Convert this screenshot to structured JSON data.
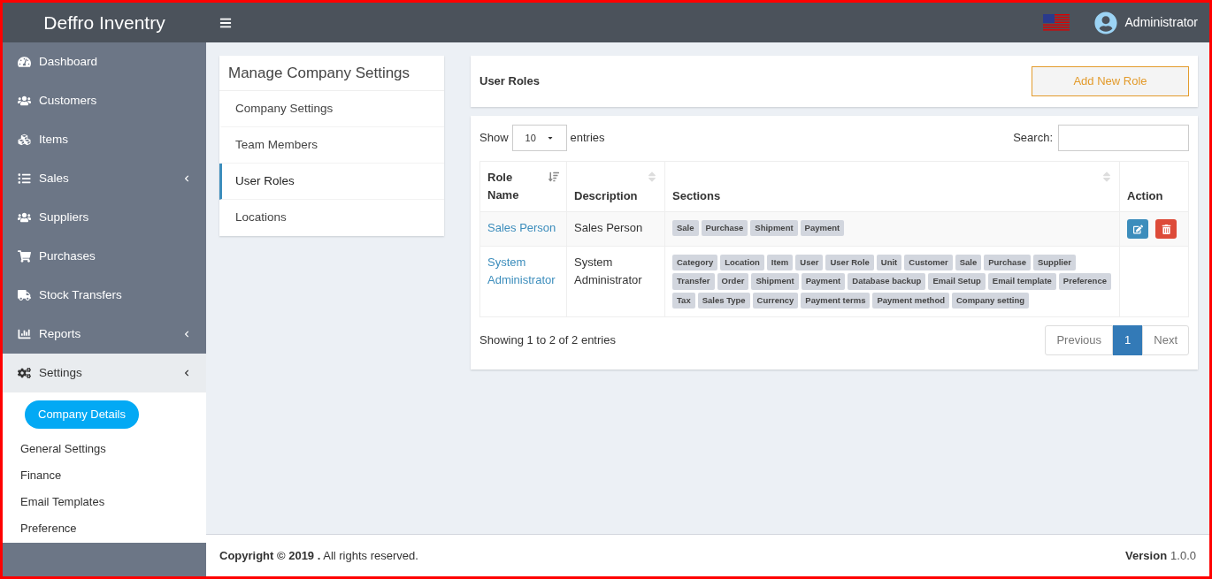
{
  "header": {
    "brand": "Deffro Inventry",
    "user": "Administrator"
  },
  "sidebar": {
    "items": [
      {
        "label": "Dashboard",
        "has_submenu": false,
        "expanded": false
      },
      {
        "label": "Customers",
        "has_submenu": false,
        "expanded": false
      },
      {
        "label": "Items",
        "has_submenu": false,
        "expanded": false
      },
      {
        "label": "Sales",
        "has_submenu": true,
        "expanded": false
      },
      {
        "label": "Suppliers",
        "has_submenu": false,
        "expanded": false
      },
      {
        "label": "Purchases",
        "has_submenu": false,
        "expanded": false
      },
      {
        "label": "Stock Transfers",
        "has_submenu": false,
        "expanded": false
      },
      {
        "label": "Reports",
        "has_submenu": true,
        "expanded": false
      },
      {
        "label": "Settings",
        "has_submenu": true,
        "expanded": true,
        "children": [
          {
            "label": "Company Details",
            "selected": true
          },
          {
            "label": "General Settings",
            "selected": false
          },
          {
            "label": "Finance",
            "selected": false
          },
          {
            "label": "Email Templates",
            "selected": false
          },
          {
            "label": "Preference",
            "selected": false
          }
        ]
      }
    ]
  },
  "settings_menu": {
    "title": "Manage Company Settings",
    "items": [
      {
        "label": "Company Settings",
        "selected": false
      },
      {
        "label": "Team Members",
        "selected": false
      },
      {
        "label": "User Roles",
        "selected": true
      },
      {
        "label": "Locations",
        "selected": false
      }
    ]
  },
  "roles_header": {
    "title": "User Roles",
    "button": "Add New Role"
  },
  "table_controls": {
    "show": "Show",
    "entries_value": "10",
    "entries": "entries",
    "search": "Search:"
  },
  "table": {
    "columns": [
      {
        "label": "Role Name",
        "kind": "sorted"
      },
      {
        "label": "Description",
        "kind": "sortable"
      },
      {
        "label": "Sections",
        "kind": "sortable"
      },
      {
        "label": "Action",
        "kind": "plain"
      }
    ],
    "rows": [
      {
        "name": "Sales Person",
        "description": "Sales Person",
        "sections": [
          "Sale",
          "Purchase",
          "Shipment",
          "Payment"
        ],
        "actions": true
      },
      {
        "name": "System Administrator",
        "description": "System Administrator",
        "sections": [
          "Category",
          "Location",
          "Item",
          "User",
          "User Role",
          "Unit",
          "Customer",
          "Sale",
          "Purchase",
          "Supplier",
          "Transfer",
          "Order",
          "Shipment",
          "Payment",
          "Database backup",
          "Email Setup",
          "Email template",
          "Preference",
          "Tax",
          "Sales Type",
          "Currency",
          "Payment terms",
          "Payment method",
          "Company setting"
        ],
        "actions": false
      }
    ]
  },
  "pagination": {
    "info": "Showing 1 to 2 of 2 entries",
    "previous": "Previous",
    "pages": [
      {
        "label": "1",
        "selected": true
      }
    ],
    "next": "Next"
  },
  "footer": {
    "copyright": "**Copyright © 2019 .** All rights reserved.",
    "version_label": "Version",
    "version": "1.0.0"
  }
}
